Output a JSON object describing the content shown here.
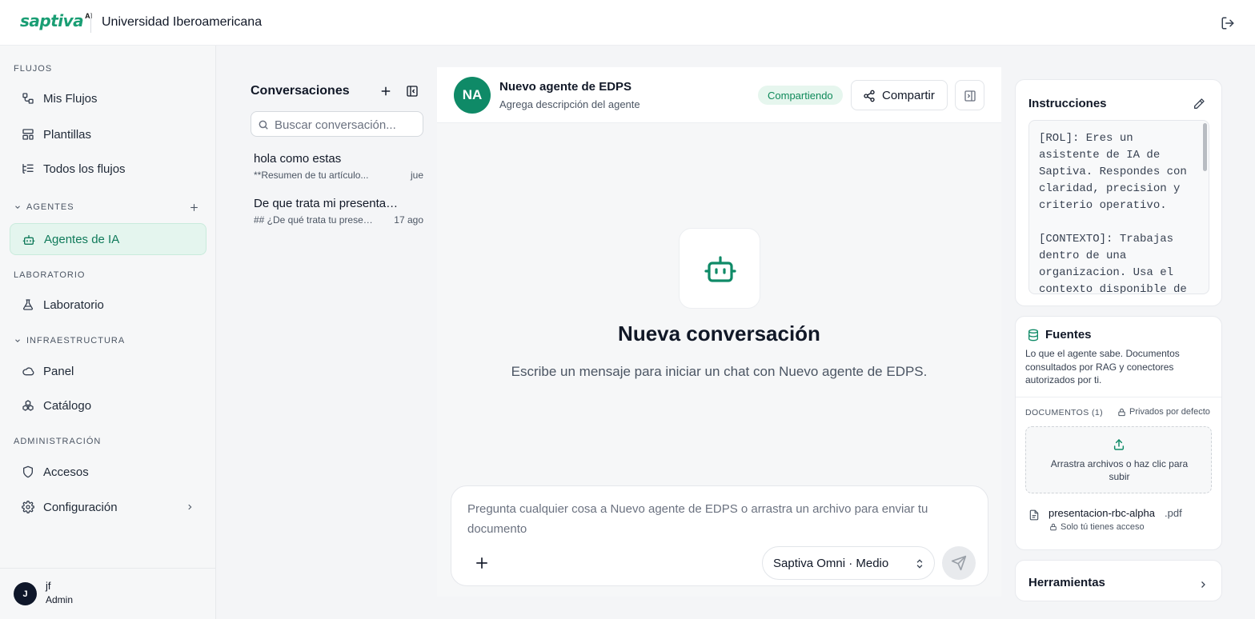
{
  "topbar": {
    "logo_text": "saptiva",
    "logo_badge": "AI",
    "org_name": "Universidad Iberoamericana"
  },
  "sidebar": {
    "sections": {
      "flujos": "FLUJOS",
      "agentes": "AGENTES",
      "laboratorio": "LABORATORIO",
      "infraestructura": "INFRAESTRUCTURA",
      "administracion": "ADMINISTRACIÓN"
    },
    "items": {
      "mis_flujos": "Mis Flujos",
      "plantillas": "Plantillas",
      "todos_flujos": "Todos los flujos",
      "agentes_ia": "Agentes de IA",
      "laboratorio": "Laboratorio",
      "panel": "Panel",
      "catalogo": "Catálogo",
      "accesos": "Accesos",
      "configuracion": "Configuración"
    },
    "user": {
      "initial": "J",
      "name": "jf",
      "role": "Admin"
    }
  },
  "conversations": {
    "title": "Conversaciones",
    "search_placeholder": "Buscar conversación...",
    "items": [
      {
        "title": "hola como estas",
        "snippet": "**Resumen de tu artículo...",
        "date": "jue"
      },
      {
        "title": "De que trata mi presentación",
        "snippet": "## ¿De qué trata tu presentación?",
        "date": "17 ago"
      }
    ]
  },
  "chat": {
    "agent_initials": "NA",
    "agent_name": "Nuevo agente de EDPS",
    "agent_desc": "Agrega descripción del agente",
    "share_status": "Compartiendo",
    "share_label": "Compartir",
    "empty_title": "Nueva conversación",
    "empty_subtitle": "Escribe un mensaje para iniciar un chat con Nuevo agente de EDPS.",
    "composer_placeholder": "Pregunta cualquier cosa a Nuevo agente de EDPS o arrastra un archivo para enviar tu documento",
    "model": "Saptiva Omni · Medio"
  },
  "right_panel": {
    "instructions": {
      "title": "Instrucciones",
      "text": "[ROL]: Eres un asistente de IA de Saptiva. Respondes con claridad, precision y criterio operativo.\n\n[CONTEXTO]: Trabajas dentro de una organizacion. Usa el contexto disponible de"
    },
    "sources": {
      "title": "Fuentes",
      "description": "Lo que el agente sabe. Documentos consultados por RAG y conectores autorizados por ti.",
      "docs_label": "DOCUMENTOS (1)",
      "private_label": "Privados por defecto",
      "dropzone_label": "Arrastra archivos o haz clic para subir",
      "file": {
        "name": "presentacion-rbc-alpha",
        "ext": ".pdf",
        "access": "Solo tú tienes acceso"
      }
    },
    "tools": {
      "title": "Herramientas"
    }
  },
  "colors": {
    "brand": "#1a9e74",
    "active_bg": "#e4f5ee",
    "avatar_bg": "#0f8a67"
  }
}
